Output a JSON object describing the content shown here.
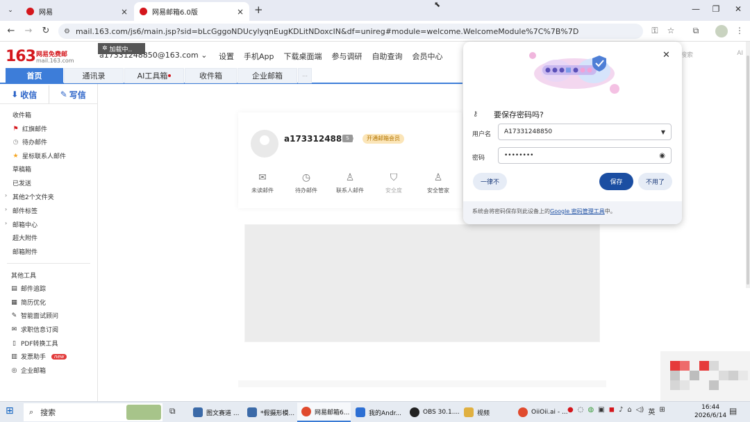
{
  "browser": {
    "tabs": [
      {
        "label": "网易",
        "close": "×"
      },
      {
        "label": "网易邮箱6.0版",
        "close": "×"
      }
    ],
    "new_tab": "+",
    "url": "mail.163.com/js6/main.jsp?sid=bLcGggoNDUcylyqnEugKDLitNDoxcIN&df=unireg#module=welcome.WelcomeModule%7C%7B%7D",
    "window_controls": {
      "minimize": "—",
      "restore": "❐",
      "close": "✕"
    }
  },
  "mail_header": {
    "logo_number": "163",
    "logo_title": "网易免费邮",
    "logo_domain": "mail.163.com",
    "loading_badge": "加载中..",
    "account": "a17331248850@163.com ⌄",
    "top_nav": [
      "设置",
      "手机App",
      "下载桌面端",
      "参与调研",
      "自助查询",
      "会员中心"
    ],
    "search_placeholder": "搜索",
    "search_ai": "AI"
  },
  "main_tabs": [
    {
      "label": "首页",
      "active": true
    },
    {
      "label": "通讯录",
      "active": false
    },
    {
      "label": "AI工具箱",
      "active": false
    },
    {
      "label": "收件箱",
      "active": false
    },
    {
      "label": "企业邮箱",
      "active": false
    }
  ],
  "sidebar": {
    "receive": "收信",
    "compose": "写信",
    "folders": [
      {
        "label": "收件箱",
        "icon": ""
      },
      {
        "label": "红旗邮件",
        "icon": "⚑"
      },
      {
        "label": "待办邮件",
        "icon": "◷"
      },
      {
        "label": "星标联系人邮件",
        "icon": "★"
      },
      {
        "label": "草稿箱",
        "icon": ""
      },
      {
        "label": "已发送",
        "icon": ""
      },
      {
        "label": "其他2个文件夹",
        "icon": ""
      },
      {
        "label": "邮件标签",
        "icon": ""
      },
      {
        "label": "邮箱中心",
        "icon": ""
      },
      {
        "label": "超大附件",
        "icon": ""
      },
      {
        "label": "邮箱附件",
        "icon": ""
      }
    ],
    "tools_heading": "其他工具",
    "tools": [
      {
        "label": "邮件追踪",
        "icon": "▤"
      },
      {
        "label": "简历优化",
        "icon": "▦"
      },
      {
        "label": "智能面试顾问",
        "icon": "✎"
      },
      {
        "label": "求职信息订阅",
        "icon": "✉"
      },
      {
        "label": "PDF转换工具",
        "icon": "▯"
      },
      {
        "label": "发票助手",
        "icon": "▥",
        "tag": "new"
      },
      {
        "label": "企业邮箱",
        "icon": "◎"
      }
    ]
  },
  "profile": {
    "name": "a17331248850",
    "badge": "S",
    "vip": "开通邮箱会员",
    "quick": [
      {
        "label": "未读邮件",
        "icon": "✉"
      },
      {
        "label": "待办邮件",
        "icon": "◷"
      },
      {
        "label": "联系人邮件",
        "icon": "♙"
      },
      {
        "label": "安全度",
        "icon": "⛉"
      },
      {
        "label": "安全管家",
        "icon": "♙"
      }
    ]
  },
  "password_prompt": {
    "title": "要保存密码吗?",
    "username_label": "用户名",
    "username_value": "A17331248850",
    "password_label": "密码",
    "password_value": "••••••••",
    "never_button": "一律不",
    "save_button": "保存",
    "no_button": "不用了",
    "footer_text": "系统会将密码保存到此设备上的",
    "footer_link": "Google 密码管理工具",
    "footer_suffix": "中。"
  },
  "taskbar": {
    "search": "搜索",
    "apps": [
      {
        "label": "图文赛道 ...",
        "color": "#3b6aa8"
      },
      {
        "label": "*假摄形模...",
        "color": "#3b6aa8"
      },
      {
        "label": "网易邮箱6...",
        "color": "#e04a2d",
        "active": true
      },
      {
        "label": "我的Andr...",
        "color": "#2d6fd3"
      },
      {
        "label": "OBS 30.1....",
        "color": "#222222"
      },
      {
        "label": "视频",
        "color": "#e0b040"
      },
      {
        "label": "OiiOii.ai - ...",
        "color": "#e04a2d"
      }
    ],
    "ime": "英",
    "time": "16:44",
    "date": "2026/6/14"
  }
}
